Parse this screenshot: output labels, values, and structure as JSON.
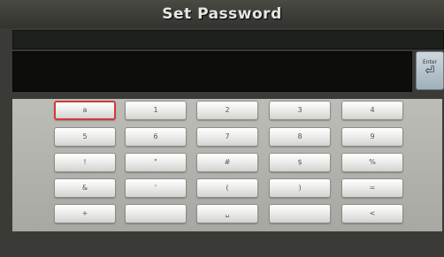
{
  "window": {
    "title": "Set Password"
  },
  "status": {
    "text": ""
  },
  "password": {
    "value": ""
  },
  "enter_key": {
    "label": "Enter",
    "glyph": "⏎"
  },
  "keypad": {
    "keys": [
      "a",
      "1",
      "2",
      "3",
      "4",
      "5",
      "6",
      "7",
      "8",
      "9",
      "!",
      "\"",
      "#",
      "$",
      "%",
      "&",
      "'",
      "(",
      ")",
      "=",
      "+",
      "",
      "␣",
      "",
      "<"
    ]
  }
}
